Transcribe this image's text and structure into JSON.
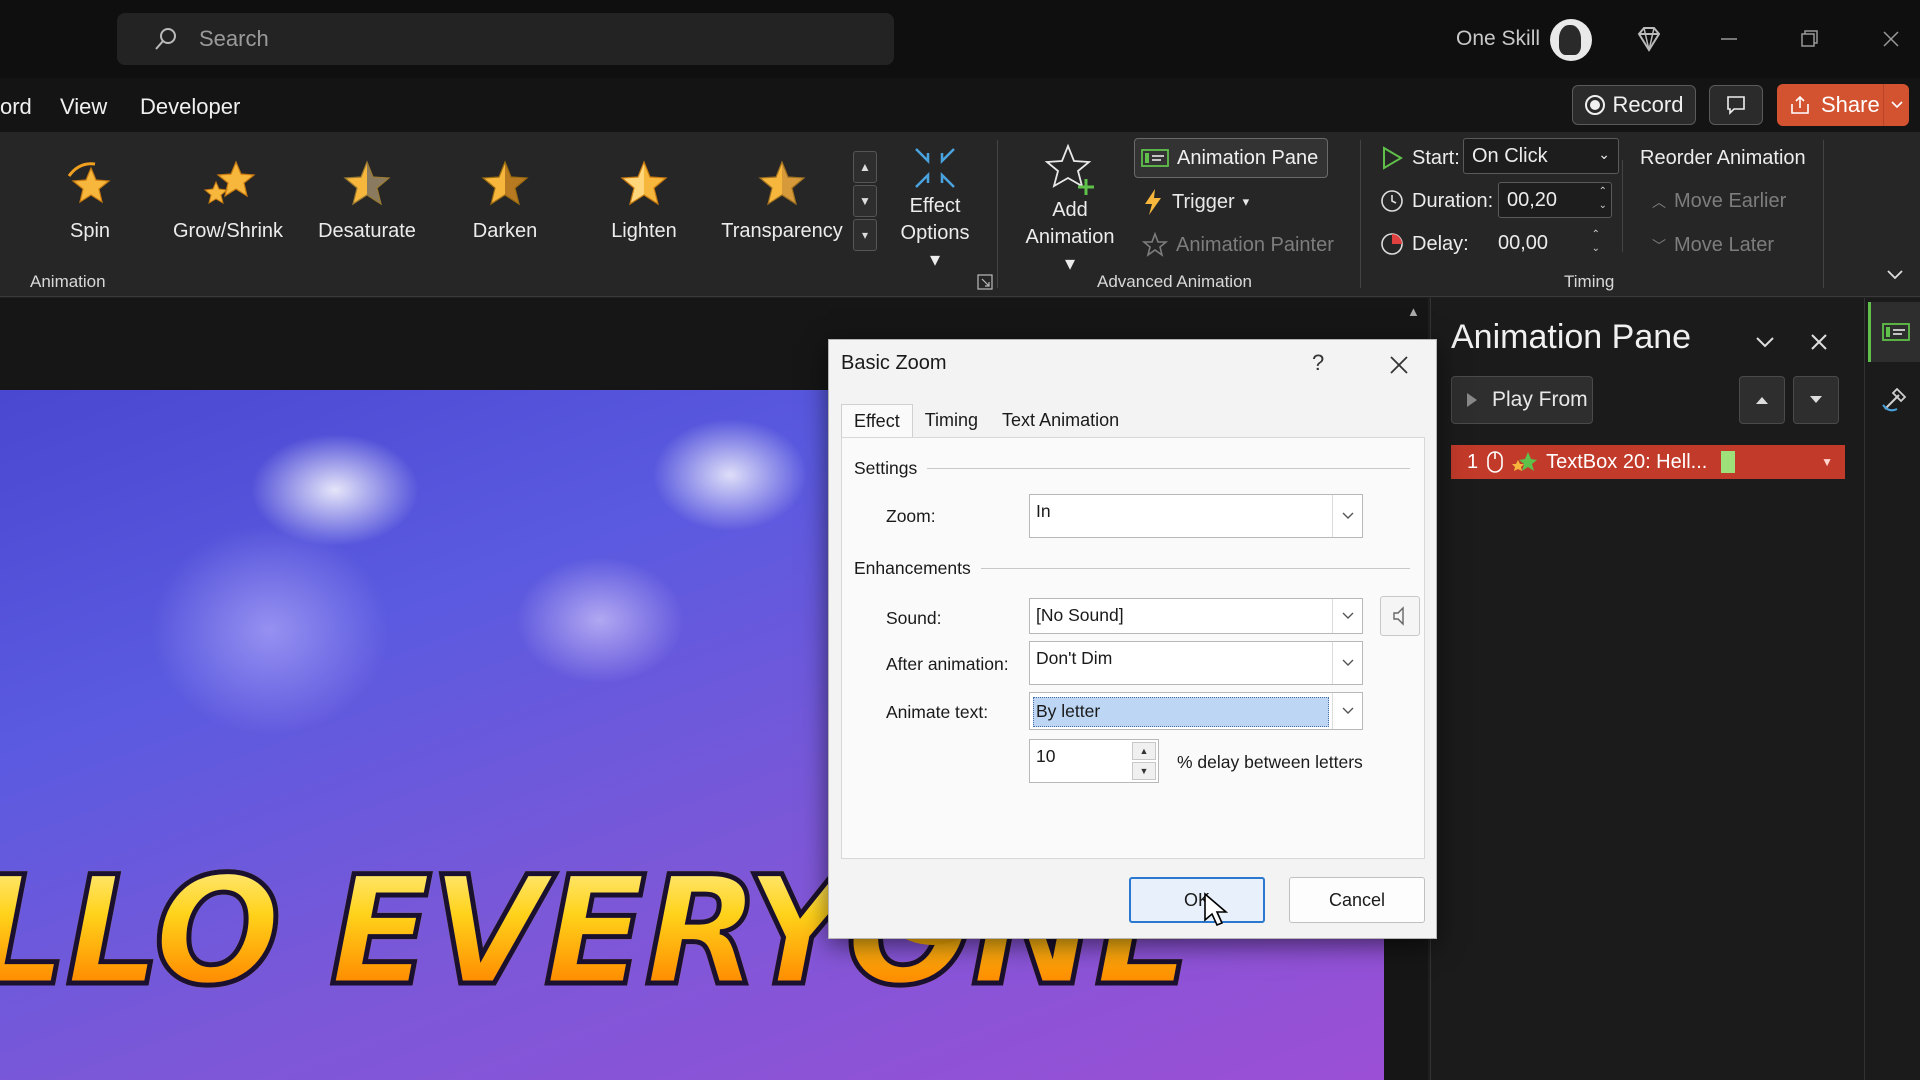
{
  "titlebar": {
    "search_placeholder": "Search",
    "user_name": "One Skill",
    "icons": [
      "search-icon",
      "diamond-icon",
      "minimize-icon",
      "restore-icon",
      "close-icon"
    ]
  },
  "menu": {
    "items": [
      "ord",
      "View",
      "Developer"
    ],
    "record_label": "Record",
    "share_label": "Share"
  },
  "ribbon": {
    "effects": [
      "Spin",
      "Grow/Shrink",
      "Desaturate",
      "Darken",
      "Lighten",
      "Transparency"
    ],
    "animation_group": "Animation",
    "effect_options": [
      "Effect",
      "Options"
    ],
    "add_animation": [
      "Add",
      "Animation"
    ],
    "animation_pane": "Animation Pane",
    "trigger": "Trigger",
    "animation_painter": "Animation Painter",
    "advanced_group": "Advanced Animation",
    "start_label": "Start:",
    "start_value": "On Click",
    "duration_label": "Duration:",
    "duration_value": "00,20",
    "delay_label": "Delay:",
    "delay_value": "00,00",
    "timing_group": "Timing",
    "reorder_title": "Reorder Animation",
    "move_earlier": "Move Earlier",
    "move_later": "Move Later"
  },
  "slide": {
    "text": "LLO EVERYONE"
  },
  "pane": {
    "title": "Animation Pane",
    "play_from": "Play From",
    "item_number": "1",
    "item_label": "TextBox 20: Hell..."
  },
  "dialog": {
    "title": "Basic Zoom",
    "help": "?",
    "tabs": [
      "Effect",
      "Timing",
      "Text Animation"
    ],
    "settings_header": "Settings",
    "zoom_label": "Zoom:",
    "zoom_value": "In",
    "enhancements_header": "Enhancements",
    "sound_label": "Sound:",
    "sound_value": "[No Sound]",
    "after_label": "After animation:",
    "after_value": "Don't Dim",
    "animate_text_label": "Animate text:",
    "animate_text_value": "By letter",
    "delay_percent": "10",
    "delay_text": "% delay between letters",
    "ok": "OK",
    "cancel": "Cancel"
  },
  "colors": {
    "accent_share": "#d35230",
    "pane_item": "#c23a2a",
    "selection": "#bcd6f3"
  }
}
